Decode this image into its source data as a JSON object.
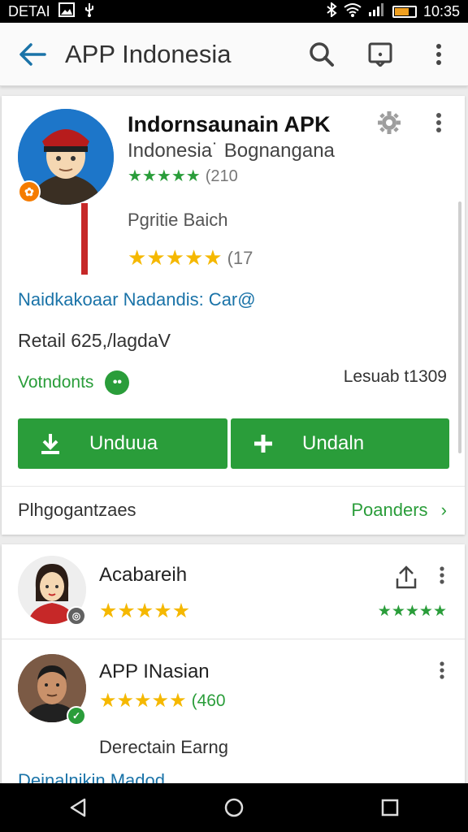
{
  "status_bar": {
    "left_text": "DETAI",
    "time": "10:35",
    "battery_level": 0.7,
    "icons": [
      "image-icon",
      "usb-icon",
      "bluetooth-icon",
      "wifi-icon",
      "signal-icon",
      "battery-icon"
    ]
  },
  "toolbar": {
    "title": "APP Indonesia",
    "icons": [
      "back-arrow-icon",
      "search-icon",
      "bookmark-icon",
      "more-vert-icon"
    ]
  },
  "app": {
    "title": "Indornsaunain APK",
    "subtitle": "Indonesia˙ Bognangana",
    "rating_count": "(210",
    "developer": "Pgritie Baich",
    "dev_rating_count": "(17",
    "rating_stars": 5,
    "dev_stars": 5,
    "link_text": "Naidkakoaar Nadandis: Car@",
    "price_text": "Retail 625,/lagdaV",
    "version_label": "Votndonts",
    "version_badge": "••",
    "size_text": "Lesuab t1309",
    "colors": {
      "accent": "#2a9d3a",
      "link": "#1a73a8",
      "star_green": "#2a9d3a",
      "star_gold": "#f5b800"
    }
  },
  "buttons": {
    "primary": "Unduua",
    "secondary": "Undaln"
  },
  "permissions": {
    "label": "Plhgogantzaes",
    "link": "Poanders",
    "chevron": "›"
  },
  "list": {
    "items": [
      {
        "title": "Acabareih",
        "stars": 5,
        "trailing_stars": 5,
        "has_share": true
      },
      {
        "title": "APP INasian",
        "stars": 5,
        "rating_count": "(460",
        "subtitle": "Derectain Earng"
      }
    ],
    "footer_partial": "Deinalnikin Madod"
  }
}
